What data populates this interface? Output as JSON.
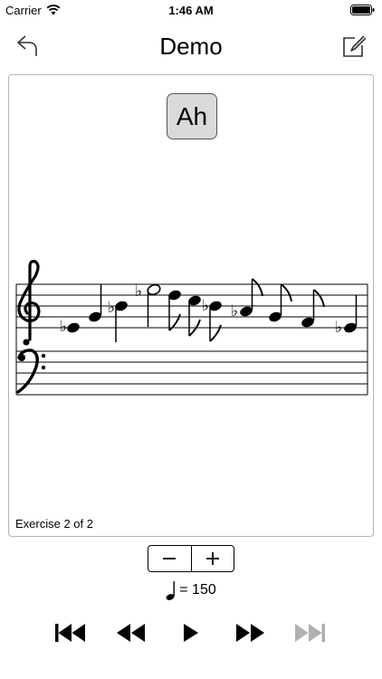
{
  "status": {
    "carrier": "Carrier",
    "time": "1:46 AM"
  },
  "nav": {
    "title": "Demo",
    "back_icon": "undo-arrow-icon",
    "edit_icon": "compose-icon"
  },
  "card": {
    "syllable": "Ah",
    "exercise_label": "Exercise 2 of 2",
    "score": {
      "clefs": [
        "treble",
        "bass"
      ],
      "notes": [
        {
          "pitch": "Eb4",
          "duration": "quarter"
        },
        {
          "pitch": "G4",
          "duration": "quarter"
        },
        {
          "pitch": "Bb4",
          "duration": "quarter"
        },
        {
          "pitch": "Eb5",
          "duration": "half"
        },
        {
          "pitch": "D5",
          "duration": "eighth"
        },
        {
          "pitch": "C5",
          "duration": "eighth"
        },
        {
          "pitch": "Bb4",
          "duration": "eighth"
        },
        {
          "pitch": "Ab4",
          "duration": "eighth"
        },
        {
          "pitch": "G4",
          "duration": "eighth"
        },
        {
          "pitch": "F4",
          "duration": "eighth"
        },
        {
          "pitch": "Eb4",
          "duration": "quarter"
        }
      ]
    }
  },
  "tempo": {
    "value": "= 150",
    "icon": "quarter-note-icon"
  },
  "stepper": {
    "minus": "−",
    "plus": "+"
  },
  "transport": {
    "skip_back_icon": "skip-to-start-icon",
    "rewind_icon": "rewind-icon",
    "play_icon": "play-icon",
    "forward_icon": "fast-forward-icon",
    "skip_forward_icon": "skip-to-end-icon",
    "disabled_color": "#b0b0b0"
  }
}
